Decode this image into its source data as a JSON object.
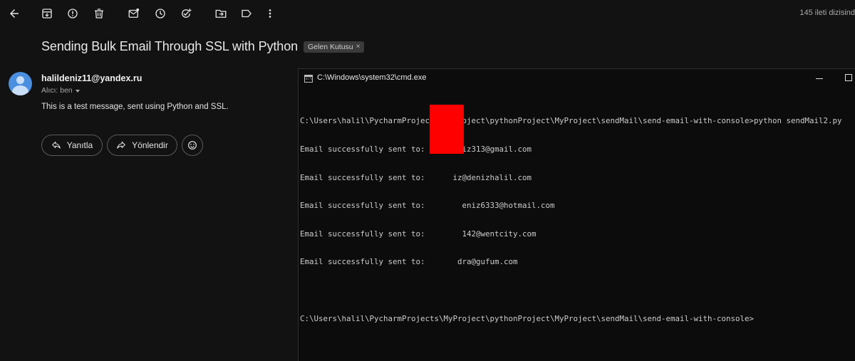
{
  "toolbar": {
    "icons": [
      "back-arrow-icon",
      "archive-icon",
      "report-spam-icon",
      "delete-icon",
      "mark-unread-icon",
      "snooze-icon",
      "add-task-icon",
      "move-to-icon",
      "label-icon",
      "more-vert-icon"
    ],
    "counter": "145 ileti dizisind"
  },
  "email": {
    "subject": "Sending Bulk Email Through SSL with Python",
    "label_chip": "Gelen Kutusu",
    "label_chip_close": "×",
    "sender": "halildeniz11@yandex.ru",
    "recipient": "Alıcı: ben",
    "body": "This is a test message, sent using Python and SSL.",
    "reply_label": "Yanıtla",
    "forward_label": "Yönlendir",
    "avatar_color": "#4a8fe0"
  },
  "cmd": {
    "title": "C:\\Windows\\system32\\cmd.exe",
    "lines": [
      "C:\\Users\\halil\\PycharmProjects\\MyProject\\pythonProject\\MyProject\\sendMail\\send-email-with-console>python sendMail2.py",
      "Email successfully sent to:",
      "Email successfully sent to:",
      "Email successfully sent to:",
      "Email successfully sent to:",
      "Email successfully sent to:",
      "",
      "C:\\Users\\halil\\PycharmProjects\\MyProject\\pythonProject\\MyProject\\sendMail\\send-email-with-console>"
    ],
    "email_suffixes": [
      "iz313@gmail.com",
      "iz@denizhalil.com",
      "eniz6333@hotmail.com",
      "142@wentcity.com",
      "dra@gufum.com"
    ],
    "redaction_color": "#ff0000"
  }
}
